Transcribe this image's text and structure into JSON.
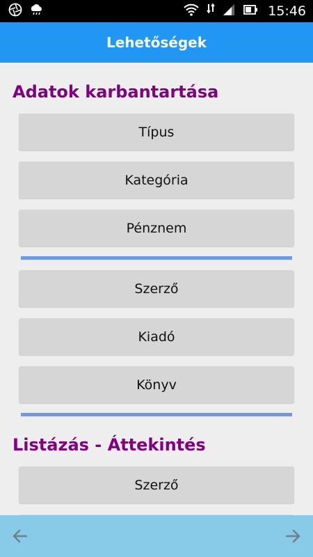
{
  "status_bar": {
    "time": "15:46",
    "icons": [
      "aperture-icon",
      "weather-icon",
      "wifi-icon",
      "no-sim-icon",
      "signal-icon",
      "battery-icon"
    ]
  },
  "app_bar": {
    "title": "Lehetőségek"
  },
  "sections": [
    {
      "title": "Adatok karbantartása",
      "buttons": [
        "Típus",
        "Kategória",
        "Pénznem",
        "Szerző",
        "Kiadó",
        "Könyv"
      ]
    },
    {
      "title": "Listázás - Áttekintés",
      "buttons": [
        "Szerző"
      ]
    }
  ],
  "bottom_bar": {
    "back_icon": "arrow-left-icon",
    "forward_icon": "arrow-right-icon"
  },
  "colors": {
    "app_bar": "#2196f3",
    "section_title": "#800080",
    "divider": "#6b9be8",
    "bottom_bar": "#87cbe9",
    "button_bg": "#d6d6d6"
  }
}
